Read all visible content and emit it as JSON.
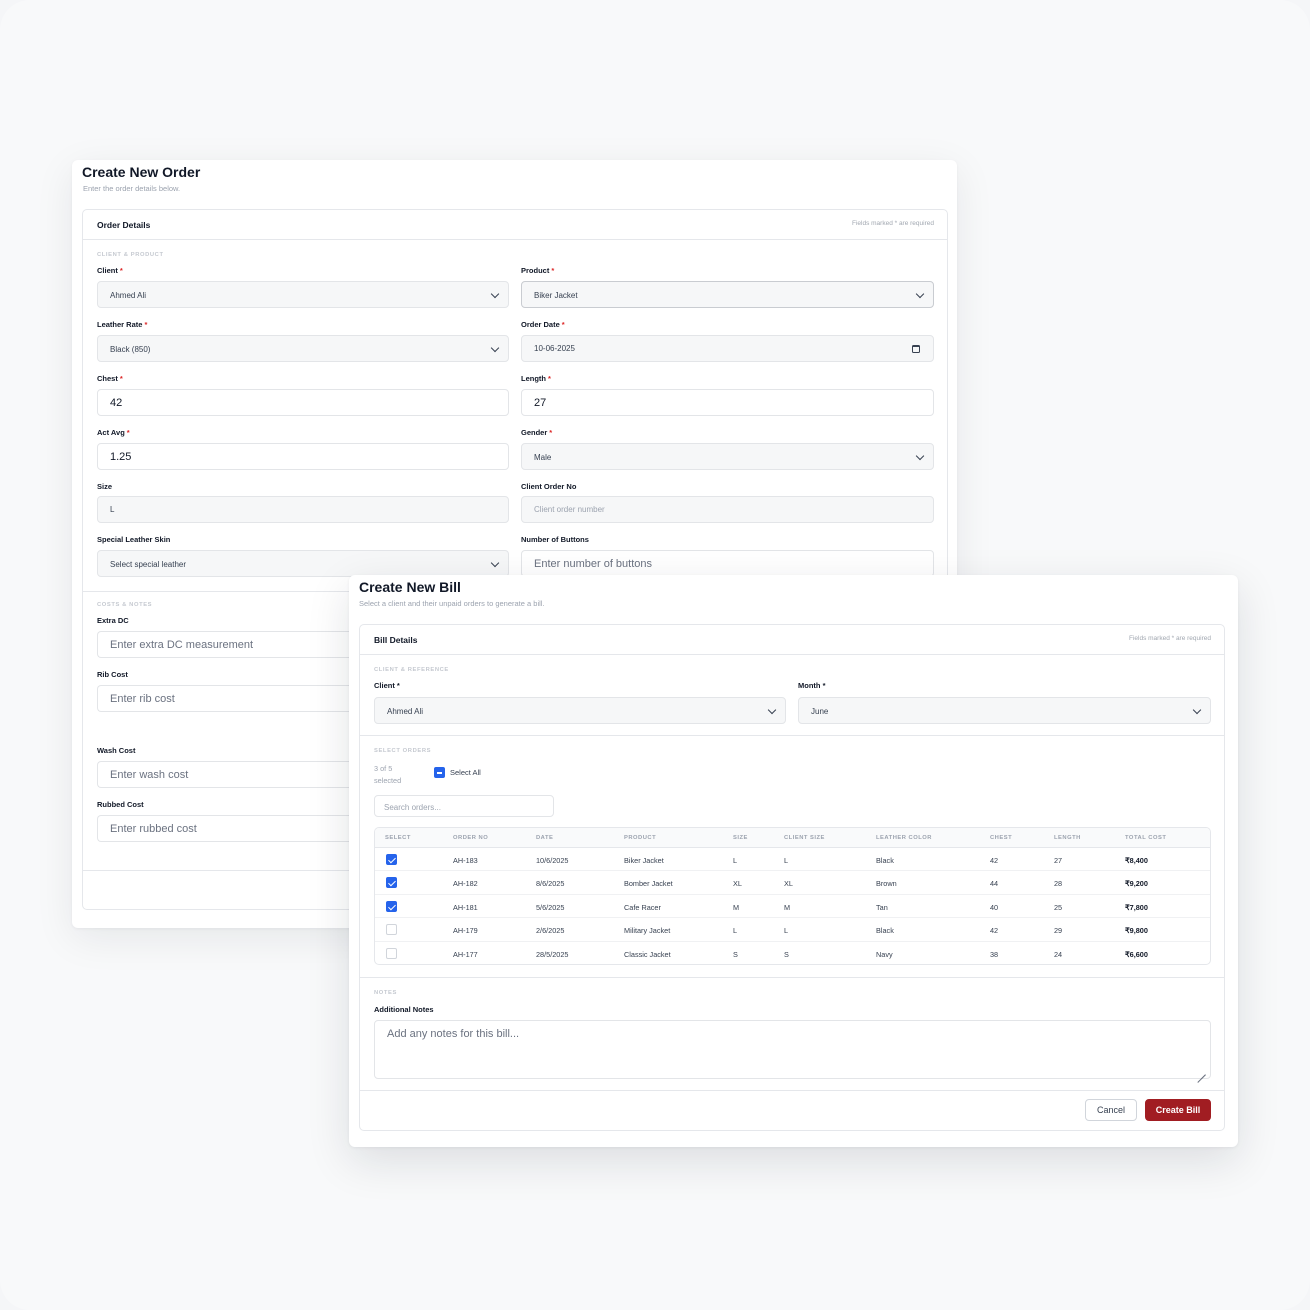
{
  "order_form": {
    "title": "Create New Order",
    "subtitle": "Enter the order details below.",
    "card_title": "Order Details",
    "required_note": "Fields marked * are required",
    "section_client_product": "CLIENT & PRODUCT",
    "section_costs_notes": "COSTS & NOTES",
    "client": {
      "label": "Client",
      "value": "Ahmed Ali"
    },
    "product": {
      "label": "Product",
      "value": "Biker Jacket"
    },
    "leather_rate": {
      "label": "Leather Rate",
      "value": "Black (850)"
    },
    "order_date": {
      "label": "Order Date",
      "value": "10-06-2025"
    },
    "chest": {
      "label": "Chest",
      "value": "42"
    },
    "length": {
      "label": "Length",
      "value": "27"
    },
    "act_avg": {
      "label": "Act Avg",
      "value": "1.25"
    },
    "gender": {
      "label": "Gender",
      "value": "Male"
    },
    "size": {
      "label": "Size",
      "value": "L"
    },
    "client_order_no": {
      "label": "Client Order No",
      "placeholder": "Client order number"
    },
    "special_leather": {
      "label": "Special Leather Skin",
      "placeholder": "Select special leather"
    },
    "number_of_buttons": {
      "label": "Number of Buttons",
      "placeholder": "Enter number of buttons"
    },
    "extra_dc": {
      "label": "Extra DC",
      "placeholder": "Enter extra DC measurement"
    },
    "rib_cost": {
      "label": "Rib Cost",
      "placeholder": "Enter rib cost"
    },
    "wash_cost": {
      "label": "Wash Cost",
      "placeholder": "Enter wash cost"
    },
    "rubbed_cost": {
      "label": "Rubbed Cost",
      "placeholder": "Enter rubbed cost"
    }
  },
  "bill_form": {
    "title": "Create New Bill",
    "subtitle": "Select a client and their unpaid orders to generate a bill.",
    "card_title": "Bill Details",
    "required_note": "Fields marked * are required",
    "section_client_reference": "CLIENT & REFERENCE",
    "client": {
      "label": "Client *",
      "value": "Ahmed Ali"
    },
    "month": {
      "label": "Month *",
      "value": "June"
    },
    "section_select_orders": "SELECT ORDERS",
    "selected_count": "3 of 5",
    "selected_word": "selected",
    "select_all_label": "Select All",
    "search_placeholder": "Search orders...",
    "columns": [
      "SELECT",
      "ORDER NO",
      "DATE",
      "PRODUCT",
      "SIZE",
      "CLIENT SIZE",
      "LEATHER COLOR",
      "CHEST",
      "LENGTH",
      "TOTAL COST"
    ],
    "rows": [
      {
        "checked": true,
        "order_no": "AH-183",
        "date": "10/6/2025",
        "product": "Biker Jacket",
        "size": "L",
        "client_size": "L",
        "color": "Black",
        "chest": "42",
        "length": "27",
        "total": "₹8,400"
      },
      {
        "checked": true,
        "order_no": "AH-182",
        "date": "8/6/2025",
        "product": "Bomber Jacket",
        "size": "XL",
        "client_size": "XL",
        "color": "Brown",
        "chest": "44",
        "length": "28",
        "total": "₹9,200"
      },
      {
        "checked": true,
        "order_no": "AH-181",
        "date": "5/6/2025",
        "product": "Cafe Racer",
        "size": "M",
        "client_size": "M",
        "color": "Tan",
        "chest": "40",
        "length": "25",
        "total": "₹7,800"
      },
      {
        "checked": false,
        "order_no": "AH-179",
        "date": "2/6/2025",
        "product": "Military Jacket",
        "size": "L",
        "client_size": "L",
        "color": "Black",
        "chest": "42",
        "length": "29",
        "total": "₹9,800"
      },
      {
        "checked": false,
        "order_no": "AH-177",
        "date": "28/5/2025",
        "product": "Classic Jacket",
        "size": "S",
        "client_size": "S",
        "color": "Navy",
        "chest": "38",
        "length": "24",
        "total": "₹6,600"
      }
    ],
    "section_notes": "NOTES",
    "notes_label": "Additional Notes",
    "notes_placeholder": "Add any notes for this bill...",
    "cancel_label": "Cancel",
    "create_label": "Create Bill",
    "accent_color": "#a11d22",
    "checkbox_color": "#2563eb"
  }
}
